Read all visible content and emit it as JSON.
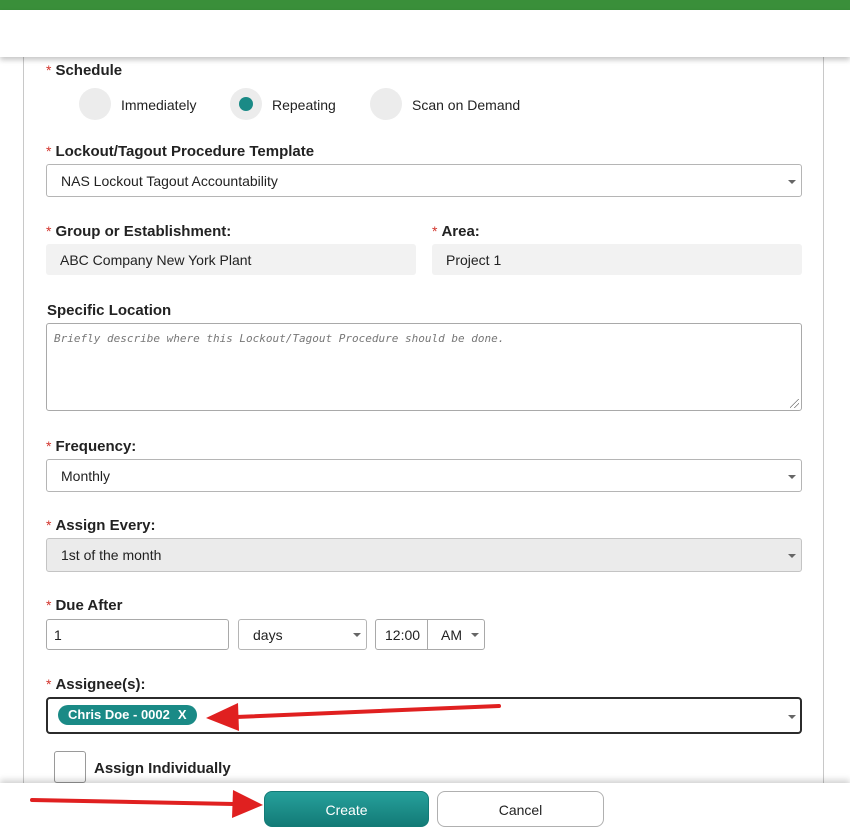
{
  "schedule": {
    "label": "Schedule",
    "options": [
      {
        "label": "Immediately",
        "checked": false
      },
      {
        "label": "Repeating",
        "checked": true
      },
      {
        "label": "Scan on Demand",
        "checked": false
      }
    ]
  },
  "template": {
    "label": "Lockout/Tagout Procedure Template",
    "value": "NAS Lockout Tagout Accountability"
  },
  "group": {
    "label": "Group or Establishment:",
    "value": "ABC Company New York Plant"
  },
  "area": {
    "label": "Area:",
    "value": "Project 1"
  },
  "location": {
    "label": "Specific Location",
    "placeholder": "Briefly describe where this Lockout/Tagout Procedure should be done."
  },
  "frequency": {
    "label": "Frequency:",
    "value": "Monthly"
  },
  "assign_every": {
    "label": "Assign Every:",
    "value": "1st of the month"
  },
  "due_after": {
    "label": "Due After",
    "amount": "1",
    "unit": "days",
    "time": "12:00",
    "ampm": "AM"
  },
  "assignees": {
    "label": "Assignee(s):",
    "chips": [
      {
        "name": "Chris Doe - 0002",
        "remove": "X"
      }
    ]
  },
  "assign_individually": {
    "label": "Assign Individually",
    "checked": false
  },
  "required_mark": "*",
  "buttons": {
    "create": "Create",
    "cancel": "Cancel"
  },
  "colors": {
    "accent": "#1a8a86",
    "topbar": "#3a8f3a",
    "required": "#d2342c",
    "annotation_arrow": "#e02020"
  }
}
